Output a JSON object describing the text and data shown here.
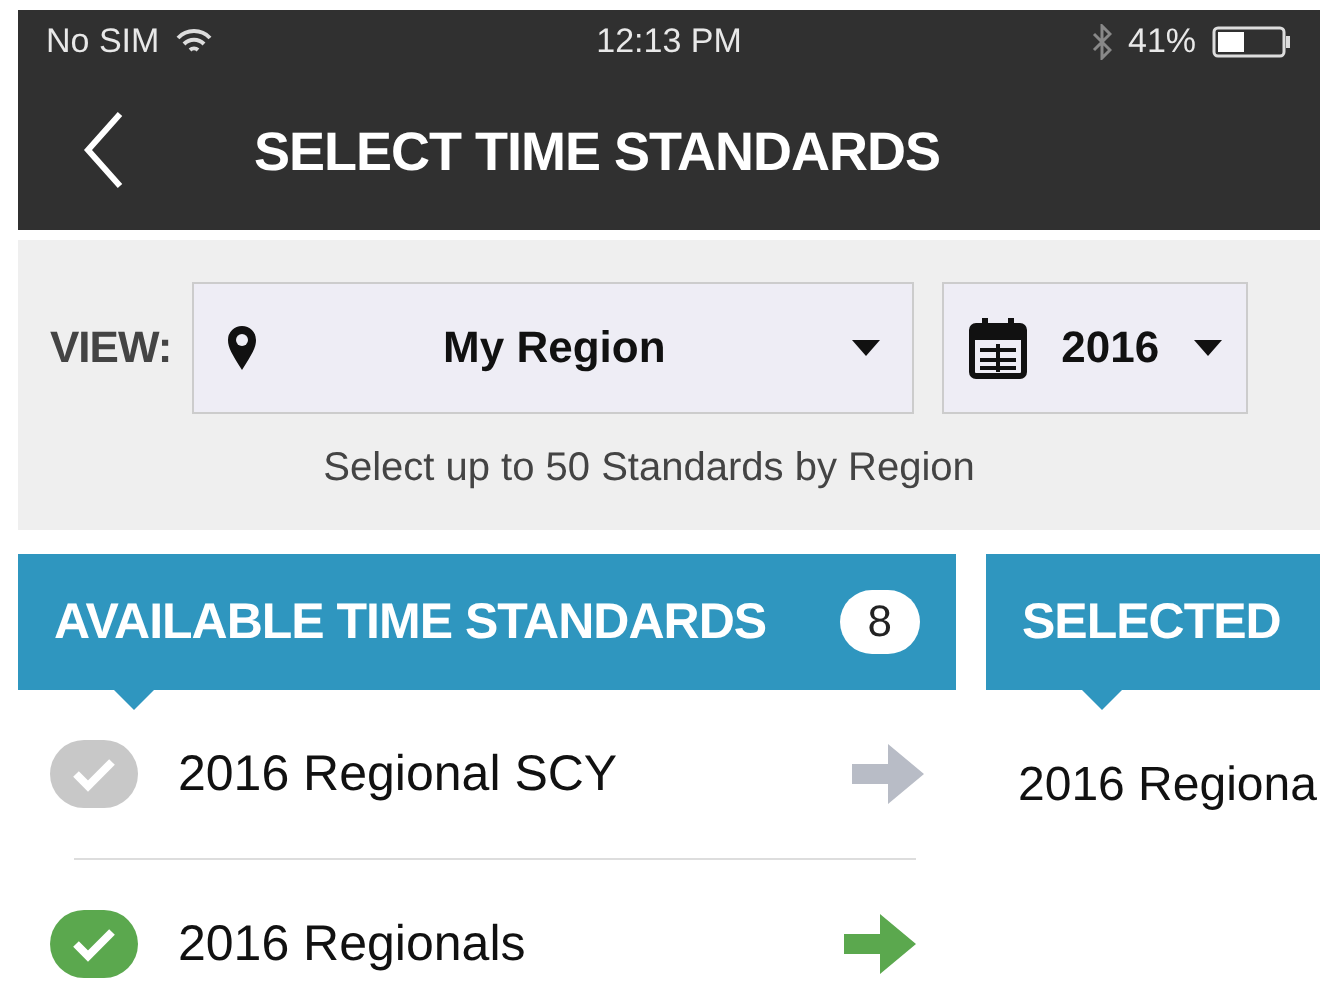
{
  "status_bar": {
    "carrier": "No SIM",
    "time": "12:13 PM",
    "battery": "41%"
  },
  "nav": {
    "title": "SELECT TIME STANDARDS"
  },
  "filters": {
    "label": "VIEW:",
    "region": "My Region",
    "year": "2016",
    "hint": "Select up to 50 Standards by Region"
  },
  "available": {
    "title": "AVAILABLE TIME STANDARDS",
    "count": "8",
    "items": [
      {
        "label": "2016 Regional SCY",
        "checked": false
      },
      {
        "label": "2016 Regionals",
        "checked": true
      }
    ]
  },
  "selected": {
    "title": "SELECTED",
    "items": [
      {
        "label": "2016 Regiona"
      }
    ]
  }
}
